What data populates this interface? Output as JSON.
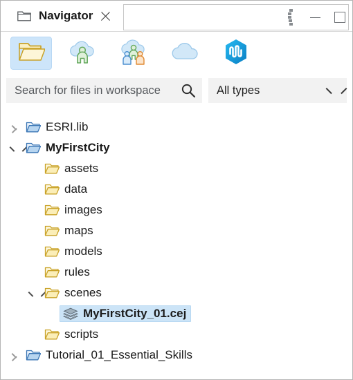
{
  "window": {
    "tab": {
      "icon": "folder-icon",
      "title": "Navigator",
      "close_icon": "close-icon"
    },
    "controls": {
      "view_menu_icon": "view-menu-icon",
      "minimize_icon": "minimize-icon",
      "maximize_icon": "maximize-icon"
    }
  },
  "toolbar": {
    "buttons": [
      {
        "name": "workspace-folder",
        "icon": "open-folder-icon",
        "active": true
      },
      {
        "name": "my-content",
        "icon": "cloud-person-icon",
        "active": false
      },
      {
        "name": "shared-content",
        "icon": "cloud-group-icon",
        "active": false
      },
      {
        "name": "cloud",
        "icon": "cloud-icon",
        "active": false
      },
      {
        "name": "arcgis-online",
        "icon": "arcgis-hexagon-icon",
        "active": false
      }
    ]
  },
  "search": {
    "placeholder": "Search for files in workspace",
    "value": "",
    "icon": "search-icon",
    "filter": {
      "selected": "All types",
      "chevron": "chevron-down-icon"
    }
  },
  "tree": {
    "rows": [
      {
        "label": "ESRI.lib",
        "indent": 0,
        "twisty": "collapsed",
        "icon": "folder-blue-icon",
        "bold": false,
        "selected": false
      },
      {
        "label": "MyFirstCity",
        "indent": 0,
        "twisty": "expanded",
        "icon": "folder-blue-icon",
        "bold": true,
        "selected": false
      },
      {
        "label": "assets",
        "indent": 1,
        "twisty": "none",
        "icon": "folder-gold-icon",
        "bold": false,
        "selected": false
      },
      {
        "label": "data",
        "indent": 1,
        "twisty": "none",
        "icon": "folder-gold-icon",
        "bold": false,
        "selected": false
      },
      {
        "label": "images",
        "indent": 1,
        "twisty": "none",
        "icon": "folder-gold-icon",
        "bold": false,
        "selected": false
      },
      {
        "label": "maps",
        "indent": 1,
        "twisty": "none",
        "icon": "folder-gold-icon",
        "bold": false,
        "selected": false
      },
      {
        "label": "models",
        "indent": 1,
        "twisty": "none",
        "icon": "folder-gold-icon",
        "bold": false,
        "selected": false
      },
      {
        "label": "rules",
        "indent": 1,
        "twisty": "none",
        "icon": "folder-gold-icon",
        "bold": false,
        "selected": false
      },
      {
        "label": "scenes",
        "indent": 1,
        "twisty": "expanded",
        "icon": "folder-gold-icon",
        "bold": false,
        "selected": false
      },
      {
        "label": "MyFirstCity_01.cej",
        "indent": 2,
        "twisty": "none",
        "icon": "scene-layers-icon",
        "bold": true,
        "selected": true
      },
      {
        "label": "scripts",
        "indent": 1,
        "twisty": "none",
        "icon": "folder-gold-icon",
        "bold": false,
        "selected": false
      },
      {
        "label": "Tutorial_01_Essential_Skills",
        "indent": 0,
        "twisty": "collapsed",
        "icon": "folder-blue-icon",
        "bold": false,
        "selected": false
      }
    ]
  },
  "colors": {
    "selection": "#cce4f7",
    "toolbar_active": "#cde5fa",
    "field_background": "#f2f2f2",
    "folder_gold": "#e3b73c",
    "folder_blue": "#4f93d6",
    "hex_blue": "#14a0e6"
  }
}
